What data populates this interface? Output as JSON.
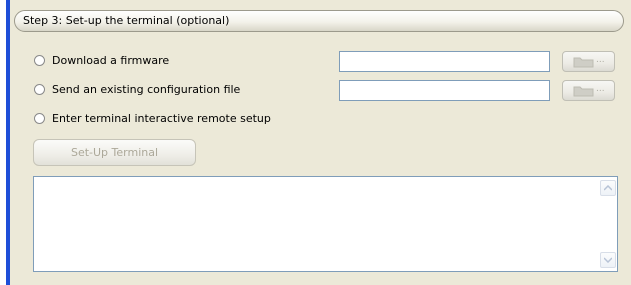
{
  "group": {
    "title": "Step 3: Set-up the terminal (optional)"
  },
  "options": [
    {
      "label": "Download a firmware"
    },
    {
      "label": "Send an existing configuration file"
    },
    {
      "label": "Enter terminal interactive remote setup"
    }
  ],
  "fields": {
    "firmware_value": "",
    "config_value": ""
  },
  "browse": {
    "icon": "folder-icon",
    "label": "..."
  },
  "buttons": {
    "setup_label": "Set-Up Terminal",
    "setup_enabled": false
  },
  "log": {
    "text": ""
  },
  "colors": {
    "accent": "#1e4ed8",
    "window_bg": "#ece9d8",
    "field_border": "#7f9db9",
    "disabled_text": "#aca899"
  }
}
